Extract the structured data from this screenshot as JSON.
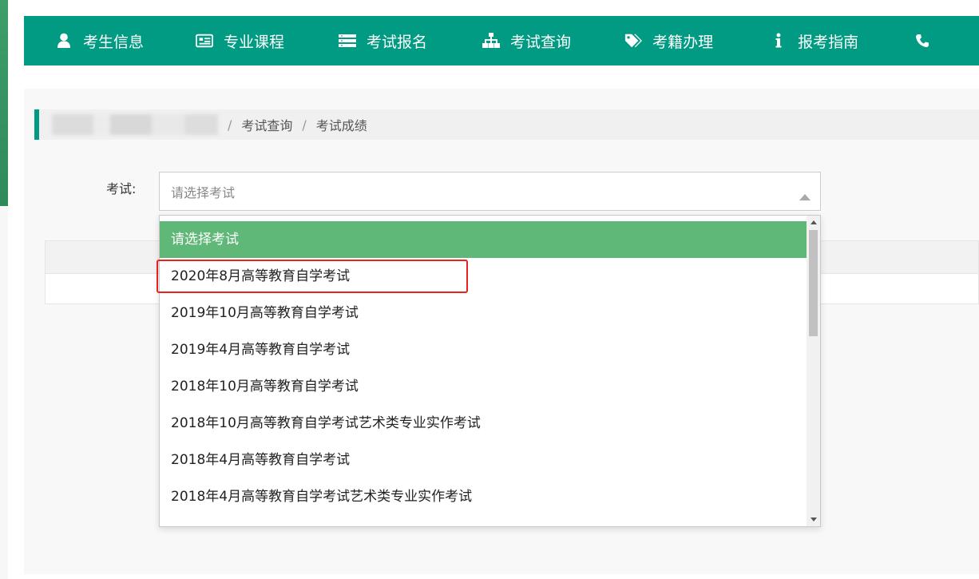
{
  "nav": {
    "items": [
      {
        "label": "考生信息",
        "icon": "user-icon"
      },
      {
        "label": "专业课程",
        "icon": "course-icon"
      },
      {
        "label": "考试报名",
        "icon": "list-icon"
      },
      {
        "label": "考试查询",
        "icon": "sitemap-icon"
      },
      {
        "label": "考籍办理",
        "icon": "tags-icon"
      },
      {
        "label": "报考指南",
        "icon": "info-icon"
      },
      {
        "label": "",
        "icon": "phone-icon"
      }
    ]
  },
  "breadcrumb": {
    "separator": "/",
    "items": [
      "考试查询",
      "考试成绩"
    ]
  },
  "form": {
    "exam_label": "考试:",
    "select_placeholder": "请选择考试"
  },
  "dropdown": {
    "options": [
      "请选择考试",
      "2020年8月高等教育自学考试",
      "2019年10月高等教育自学考试",
      "2019年4月高等教育自学考试",
      "2018年10月高等教育自学考试",
      "2018年10月高等教育自学考试艺术类专业实作考试",
      "2018年4月高等教育自学考试",
      "2018年4月高等教育自学考试艺术类专业实作考试"
    ],
    "selected_option": "请选择考试",
    "highlighted_option": "2020年8月高等教育自学考试"
  },
  "colors": {
    "nav_bg": "#009b82",
    "selected_bg": "#5fb878",
    "highlight_border": "#e8231e"
  }
}
